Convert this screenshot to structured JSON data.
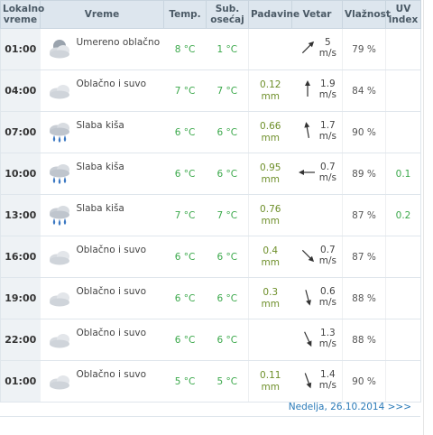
{
  "headers": {
    "time": "Lokalno vreme",
    "weather": "Vreme",
    "temp": "Temp.",
    "feel": "Sub. osećaj",
    "precip": "Padavine",
    "wind": "Vetar",
    "humidity": "Vlažnost",
    "uv": "UV index"
  },
  "rows": [
    {
      "time": "01:00",
      "icon": "partly-cloudy-night-icon",
      "desc": "Umereno oblačno",
      "temp": "8 °C",
      "feel": "1 °C",
      "precip_val": "",
      "precip_unit": "",
      "wind_dir": "southwest-arrow-icon",
      "wind_deg": 225,
      "wind_val": "5",
      "wind_unit": "m/s",
      "humidity": "79 %",
      "uv": ""
    },
    {
      "time": "04:00",
      "icon": "cloud-icon",
      "desc": "Oblačno i suvo",
      "temp": "7 °C",
      "feel": "7 °C",
      "precip_val": "0.12",
      "precip_unit": "mm",
      "wind_dir": "south-arrow-icon",
      "wind_deg": 180,
      "wind_val": "1.9",
      "wind_unit": "m/s",
      "humidity": "84 %",
      "uv": ""
    },
    {
      "time": "07:00",
      "icon": "rain-cloud-icon",
      "desc": "Slaba kiša",
      "temp": "6 °C",
      "feel": "6 °C",
      "precip_val": "0.66",
      "precip_unit": "mm",
      "wind_dir": "south-arrow-icon",
      "wind_deg": 170,
      "wind_val": "1.7",
      "wind_unit": "m/s",
      "humidity": "90 %",
      "uv": ""
    },
    {
      "time": "10:00",
      "icon": "rain-cloud-icon",
      "desc": "Slaba kiša",
      "temp": "6 °C",
      "feel": "6 °C",
      "precip_val": "0.95",
      "precip_unit": "mm",
      "wind_dir": "east-arrow-icon",
      "wind_deg": 90,
      "wind_val": "0.7",
      "wind_unit": "m/s",
      "humidity": "89 %",
      "uv": "0.1"
    },
    {
      "time": "13:00",
      "icon": "rain-cloud-icon",
      "desc": "Slaba kiša",
      "temp": "7 °C",
      "feel": "7 °C",
      "precip_val": "0.76",
      "precip_unit": "mm",
      "wind_dir": "",
      "wind_deg": null,
      "wind_val": "",
      "wind_unit": "",
      "humidity": "87 %",
      "uv": "0.2"
    },
    {
      "time": "16:00",
      "icon": "cloud-icon",
      "desc": "Oblačno i suvo",
      "temp": "6 °C",
      "feel": "6 °C",
      "precip_val": "0.4",
      "precip_unit": "mm",
      "wind_dir": "northwest-arrow-icon",
      "wind_deg": 315,
      "wind_val": "0.7",
      "wind_unit": "m/s",
      "humidity": "87 %",
      "uv": ""
    },
    {
      "time": "19:00",
      "icon": "cloud-icon",
      "desc": "Oblačno i suvo",
      "temp": "6 °C",
      "feel": "6 °C",
      "precip_val": "0.3",
      "precip_unit": "mm",
      "wind_dir": "north-arrow-icon",
      "wind_deg": 345,
      "wind_val": "0.6",
      "wind_unit": "m/s",
      "humidity": "88 %",
      "uv": ""
    },
    {
      "time": "22:00",
      "icon": "cloud-icon",
      "desc": "Oblačno i suvo",
      "temp": "6 °C",
      "feel": "6 °C",
      "precip_val": "",
      "precip_unit": "",
      "wind_dir": "north-arrow-icon",
      "wind_deg": 335,
      "wind_val": "1.3",
      "wind_unit": "m/s",
      "humidity": "88 %",
      "uv": ""
    },
    {
      "time": "01:00",
      "icon": "cloud-icon",
      "desc": "Oblačno i suvo",
      "temp": "5 °C",
      "feel": "5 °C",
      "precip_val": "0.11",
      "precip_unit": "mm",
      "wind_dir": "north-arrow-icon",
      "wind_deg": 340,
      "wind_val": "1.4",
      "wind_unit": "m/s",
      "humidity": "90 %",
      "uv": ""
    }
  ],
  "footer": {
    "next_link": "Nedelja, 26.10.2014 >>>"
  },
  "colors": {
    "header_bg": "#dde6ee",
    "temp": "#3aa84a",
    "precip": "#6e8f2a",
    "link": "#2a7ab8"
  }
}
